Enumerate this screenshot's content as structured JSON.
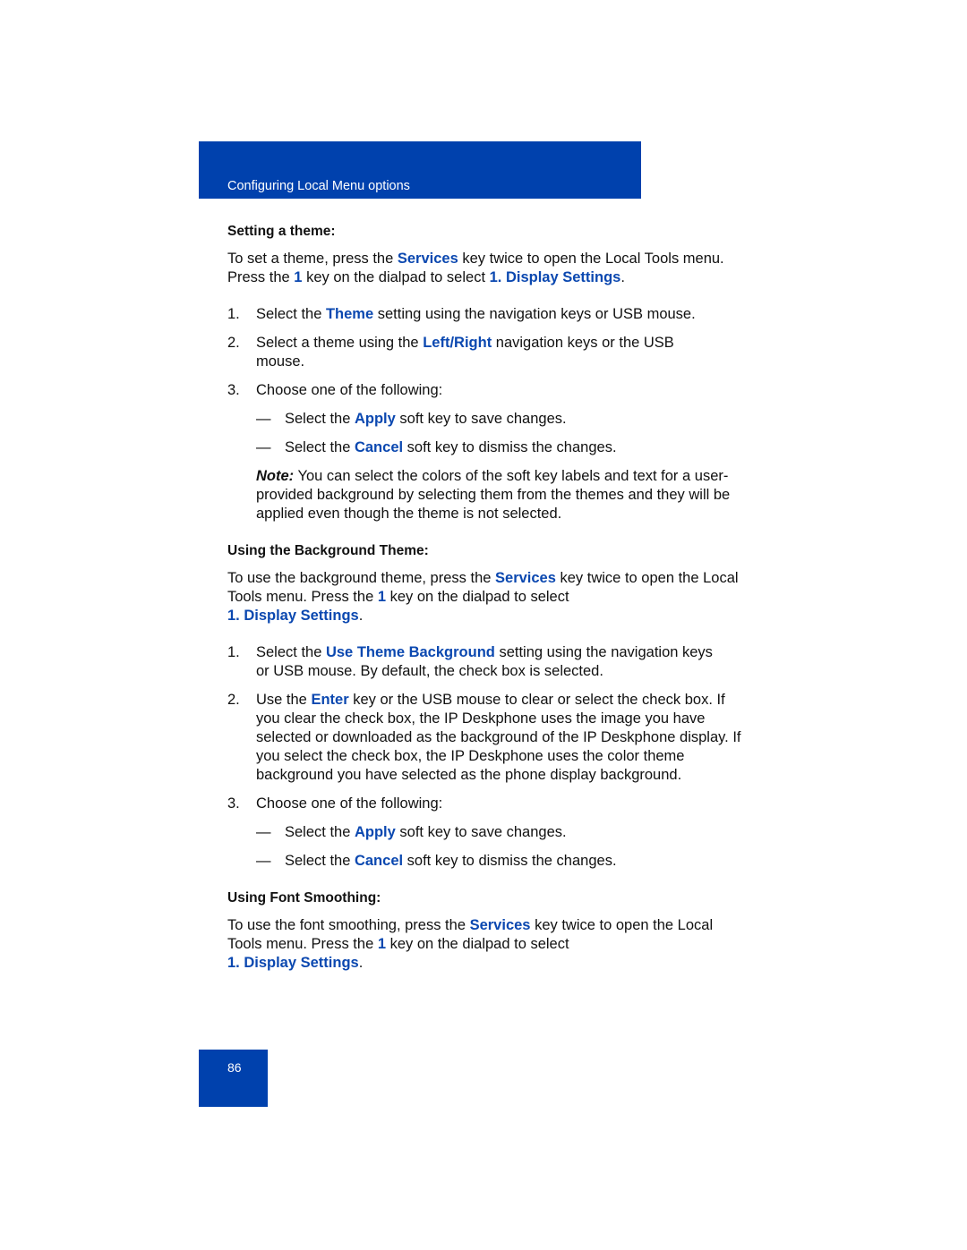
{
  "header": {
    "title": "Configuring Local Menu options"
  },
  "sections": [
    {
      "heading": "Setting a theme:",
      "intro": {
        "t1": "To set a theme, press the ",
        "k1": "Services",
        "t2": " key twice to open the Local Tools menu. Press the ",
        "k2": "1",
        "t3": " key on the dialpad to select ",
        "k3": "1. Display Settings",
        "t4": "."
      },
      "steps": [
        {
          "num": "1.",
          "t1": "Select the ",
          "k1": "Theme",
          "t2": " setting using the navigation keys or USB mouse."
        },
        {
          "num": "2.",
          "t1": "Select a theme using the ",
          "k1": "Left",
          "sep": "/",
          "k2": "Right",
          "t2": " navigation keys or the USB mouse."
        },
        {
          "num": "3.",
          "t1": "Choose one of the following:"
        }
      ],
      "options": [
        {
          "dash": "—",
          "t1": "Select the ",
          "k1": "Apply",
          "t2": " soft key to save changes."
        },
        {
          "dash": "—",
          "t1": "Select the ",
          "k1": "Cancel",
          "t2": " soft key to dismiss the changes."
        }
      ],
      "note": {
        "label": "Note:",
        "text": " You can select the colors of the soft key labels and text for a user-provided background by selecting them from the themes and they will be applied even though the theme is not selected."
      }
    },
    {
      "heading": "Using the Background Theme:",
      "intro": {
        "t1": "To use the background theme, press the ",
        "k1": "Services",
        "t2": " key twice to open the Local Tools menu. Press the ",
        "k2": "1",
        "t3": " key on the dialpad to select",
        "k3": "1. Display Settings",
        "t4": "."
      },
      "steps": [
        {
          "num": "1.",
          "t1": "Select the ",
          "k1": "Use Theme Background",
          "t2": " setting using the navigation keys or USB mouse. By default, the check box is selected."
        },
        {
          "num": "2.",
          "t1": "Use the ",
          "k1": "Enter",
          "t2": " key or the USB mouse to clear or select the check box. If you clear the check box, the IP Deskphone uses the image you have selected or downloaded as the background of the IP Deskphone display. If you select the check box, the IP Deskphone uses the color theme background you have selected as the phone display background."
        },
        {
          "num": "3.",
          "t1": "Choose one of the following:"
        }
      ],
      "options": [
        {
          "dash": "—",
          "t1": "Select the ",
          "k1": "Apply",
          "t2": " soft key to save changes."
        },
        {
          "dash": "—",
          "t1": "Select the ",
          "k1": "Cancel",
          "t2": " soft key to dismiss the changes."
        }
      ]
    },
    {
      "heading": "Using Font Smoothing:",
      "intro": {
        "t1": "To use the font smoothing, press the ",
        "k1": "Services",
        "t2": " key twice to open the Local Tools menu. Press the ",
        "k2": "1",
        "t3": " key on the dialpad to select",
        "k3": "1. Display Settings",
        "t4": "."
      }
    }
  ],
  "footer": {
    "page_number": "86"
  },
  "colors": {
    "brand_blue": "#0041ad",
    "keyword_blue": "#0b48b0"
  }
}
